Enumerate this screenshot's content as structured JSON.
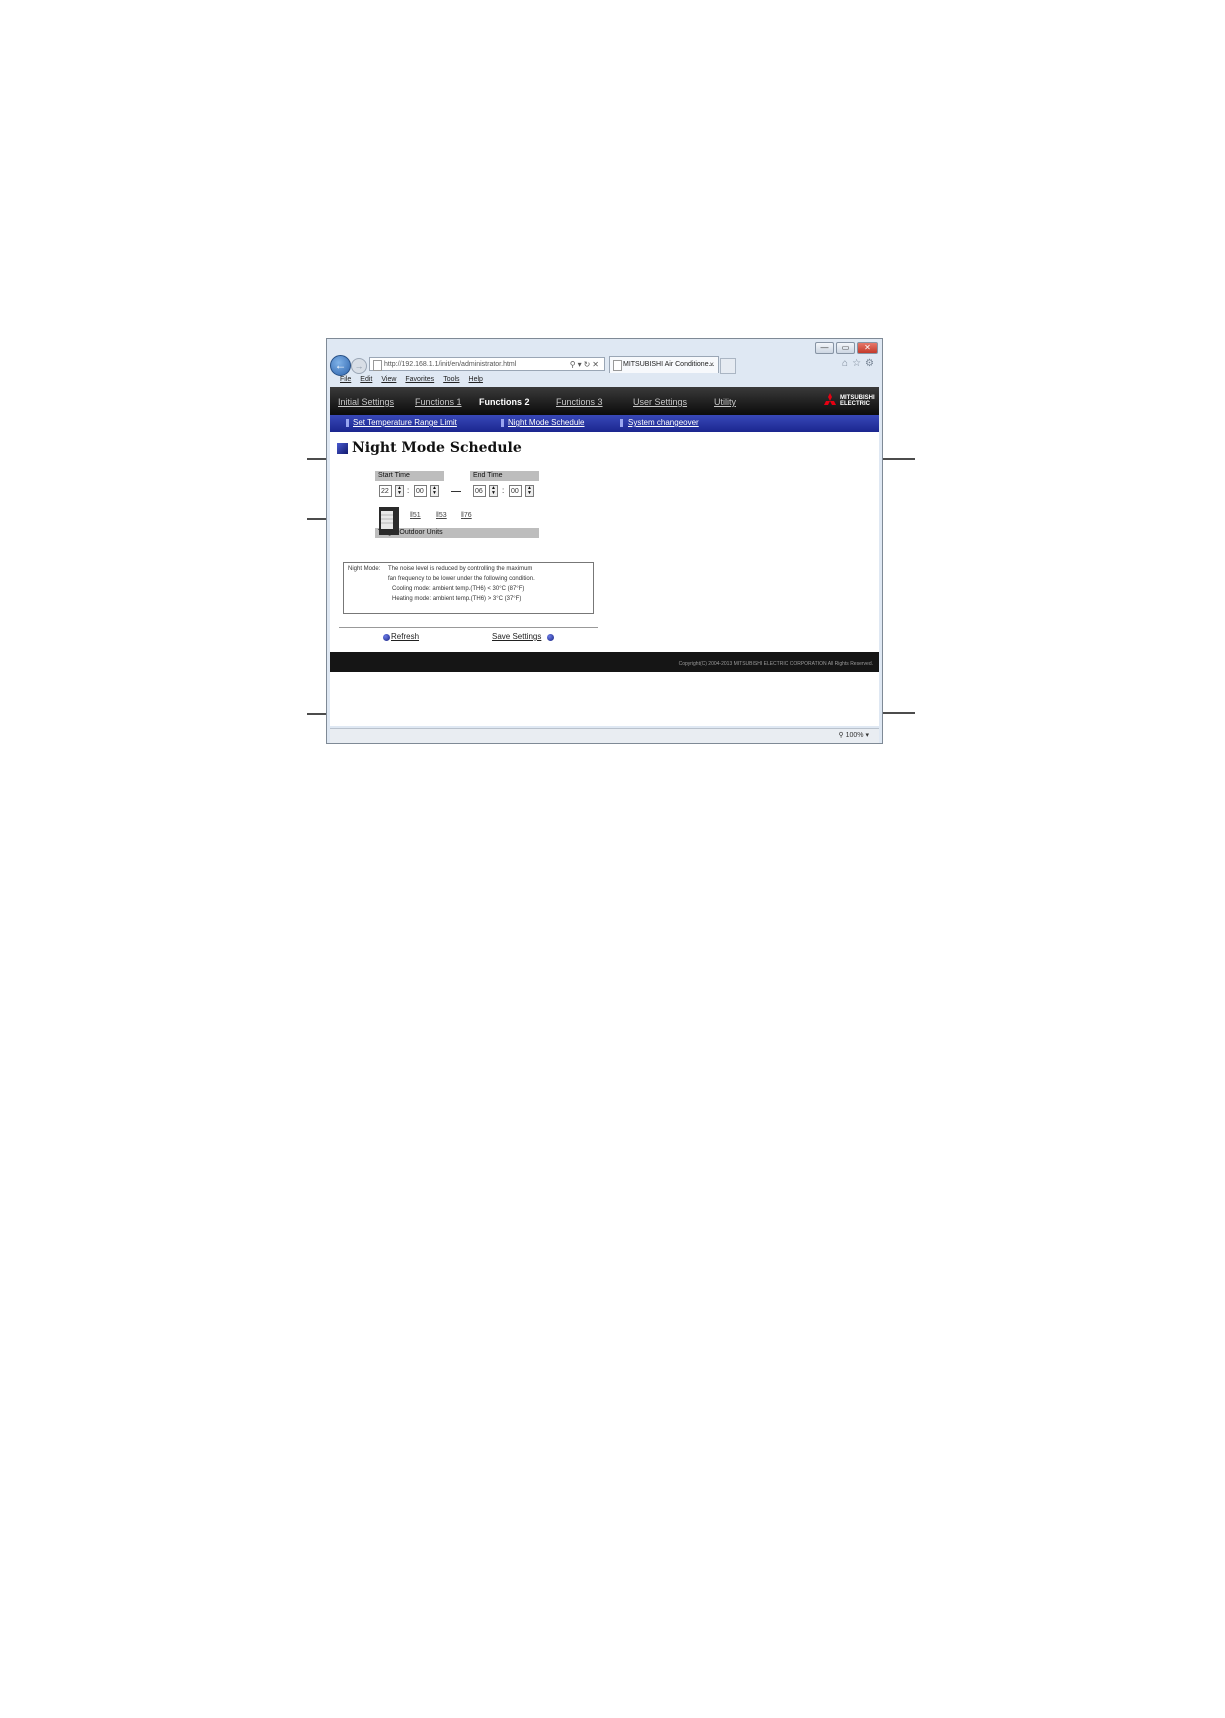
{
  "browser": {
    "address": "http://192.168.1.1/init/en/administrator.html",
    "tab_title": "MITSUBISHI Air Conditione...",
    "tab_close": "×",
    "window_controls": {
      "minimize": "—",
      "restore": "▭",
      "close": "✕"
    },
    "menu": [
      "File",
      "Edit",
      "View",
      "Favorites",
      "Tools",
      "Help"
    ],
    "zoom": "100%"
  },
  "nav": {
    "items": [
      "Initial Settings",
      "Functions 1",
      "Functions 2",
      "Functions 3",
      "User Settings",
      "Utility"
    ],
    "active": "Functions 2"
  },
  "subnav": {
    "items": [
      "Set Temperature Range Limit",
      "Night Mode Schedule",
      "System changeover"
    ]
  },
  "logo": {
    "line1": "MITSUBISHI",
    "line2": "ELECTRIC"
  },
  "page": {
    "title": "Night Mode Schedule",
    "start_time": {
      "label": "Start Time",
      "hour": "22",
      "minute": "00"
    },
    "end_time": {
      "label": "End Time",
      "hour": "06",
      "minute": "00"
    },
    "separator": ":",
    "target_units": {
      "label": "Target Outdoor Units",
      "units": [
        "51",
        "53",
        "76"
      ]
    },
    "note": {
      "label": "Night Mode:",
      "lines": [
        "The noise level is reduced by controlling the maximum",
        "fan frequency to be lower under the following condition.",
        "Cooling mode: ambient temp.(TH6) < 30°C (87°F)",
        "Heating mode: ambient temp.(TH6) > 3°C (37°F)"
      ]
    },
    "refresh_label": "Refresh",
    "save_label": "Save Settings",
    "copyright": "Copyright(C) 2004-2013 MITSUBISHI ELECTRIC CORPORATION All Rights Reserved."
  }
}
